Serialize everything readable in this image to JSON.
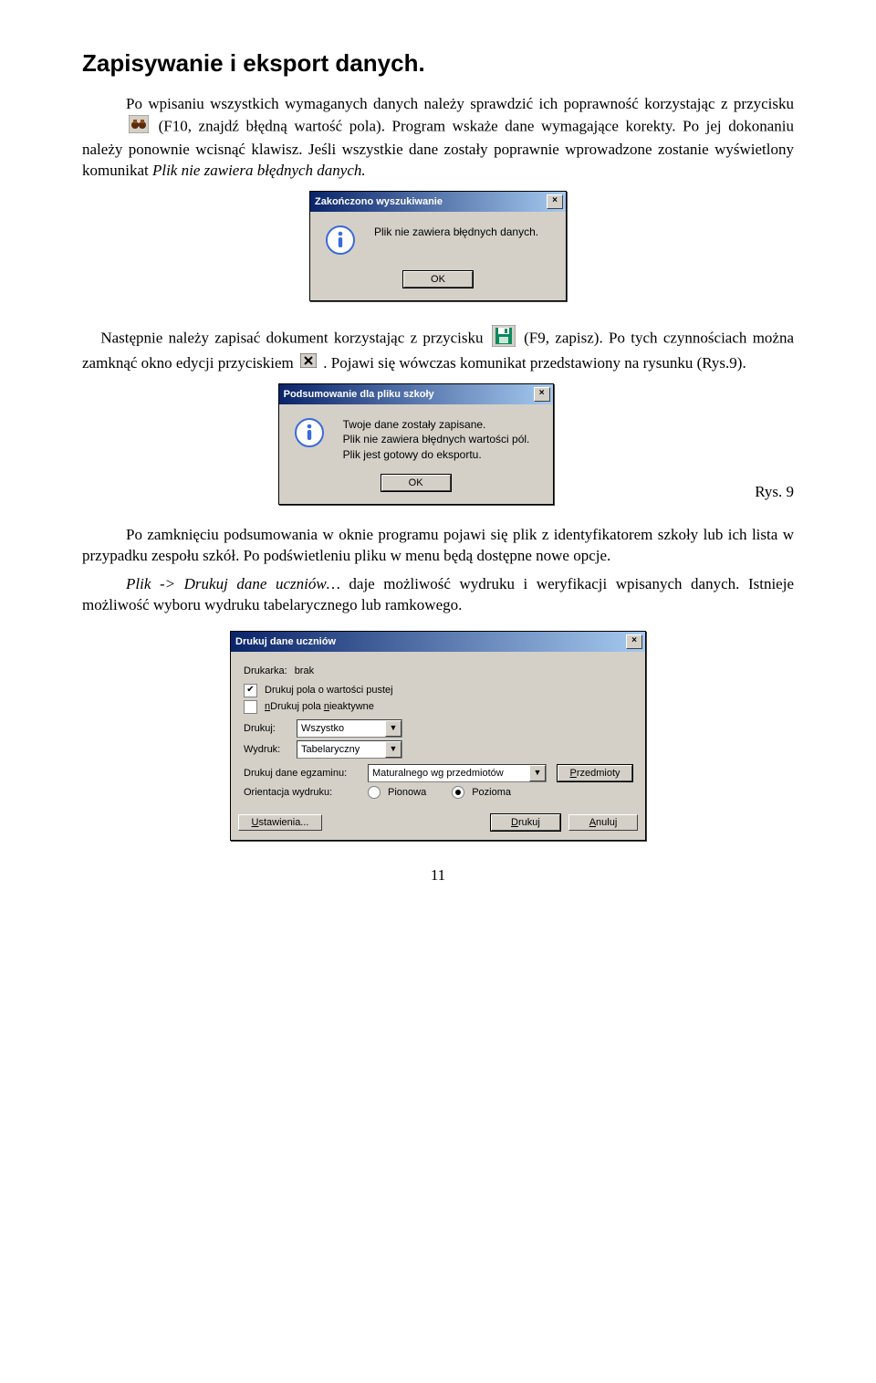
{
  "heading": "Zapisywanie i eksport danych.",
  "para1_a": "Po wpisaniu wszystkich wymaganych danych należy sprawdzić ich poprawność korzystając z przycisku ",
  "para1_b": " (F10, znajdź błędną wartość pola). Program wskaże dane wymagające korekty. Po jej dokonaniu należy ponownie wcisnąć klawisz. Jeśli wszystkie dane zostały poprawnie wprowadzone zostanie wyświetlony komunikat ",
  "para1_c": "Plik nie zawiera błędnych danych.",
  "dialog1": {
    "title": "Zakończono wyszukiwanie",
    "msg": "Plik nie zawiera błędnych danych.",
    "ok": "OK"
  },
  "para2_a": "Następnie należy zapisać dokument korzystając z przycisku ",
  "para2_b": " (F9, zapisz). Po tych czynnościach można zamknąć okno edycji przyciskiem ",
  "para2_c": ". Pojawi się wówczas komunikat przedstawiony na rysunku (Rys.9).",
  "dialog2": {
    "title": "Podsumowanie dla pliku szkoły",
    "line1": "Twoje dane zostały zapisane.",
    "line2": "Plik nie zawiera błędnych wartości pól.",
    "line3": "Plik jest gotowy do eksportu.",
    "ok": "OK"
  },
  "fig_caption": "Rys. 9",
  "para3": "Po zamknięciu podsumowania w oknie programu pojawi się plik z identyfikatorem szkoły lub ich lista w przypadku zespołu szkół. Po podświetleniu pliku w menu będą dostępne nowe opcje.",
  "para4_a": "Plik -> Drukuj dane uczniów…",
  "para4_b": " daje możliwość wydruku i weryfikacji wpisanych danych. Istnieje możliwość wyboru wydruku tabelarycznego lub ramkowego.",
  "dialog3": {
    "title": "Drukuj dane uczniów",
    "printer_label": "Drukarka:",
    "printer_value": "brak",
    "cb1": "Drukuj pola o wartości pustej",
    "cb2": "Drukuj pola nieaktywne",
    "drukuj_label": "Drukuj:",
    "drukuj_value": "Wszystko",
    "wydruk_label": "Wydruk:",
    "wydruk_value": "Tabelaryczny",
    "exam_label": "Drukuj dane egzaminu:",
    "exam_value": "Maturalnego wg przedmiotów",
    "przedmioty": "Przedmioty",
    "orient_label": "Orientacja wydruku:",
    "orient_v": "Pionowa",
    "orient_h": "Pozioma",
    "ustawienia": "Ustawienia...",
    "drukuj_btn": "Drukuj",
    "anuluj": "Anuluj"
  },
  "page_number": "11"
}
